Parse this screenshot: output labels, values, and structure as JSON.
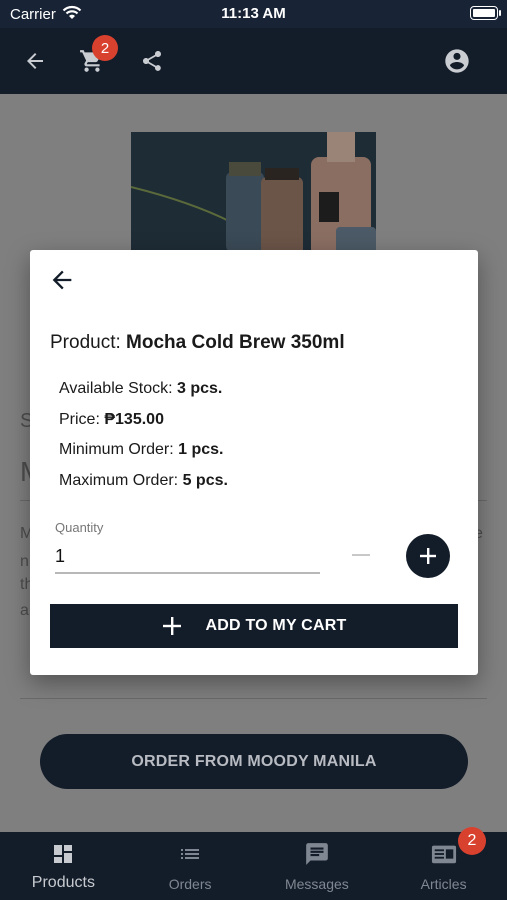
{
  "status_bar": {
    "carrier": "Carrier",
    "time": "11:13 AM"
  },
  "app_bar": {
    "cart_count": "2"
  },
  "background": {
    "section_label_partial": "S",
    "title_partial": "M",
    "desc_lines_partial": [
      "M",
      "n",
      "th",
      "a"
    ],
    "desc_right_partial": "e",
    "order_button": "ORDER FROM MOODY MANILA"
  },
  "dialog": {
    "product_label": "Product:",
    "product_name": "Mocha Cold Brew 350ml",
    "stock_label": "Available Stock:",
    "stock_value": "3 pcs.",
    "price_label": "Price:",
    "price_value": "₱135.00",
    "min_label": "Minimum Order:",
    "min_value": "1 pcs.",
    "max_label": "Maximum Order:",
    "max_value": "5 pcs.",
    "quantity_label": "Quantity",
    "quantity_value": "1",
    "add_button": "ADD TO MY CART"
  },
  "tabs": [
    {
      "label": "Products",
      "icon": "dashboard-icon",
      "active": true
    },
    {
      "label": "Orders",
      "icon": "list-icon",
      "active": false
    },
    {
      "label": "Messages",
      "icon": "message-icon",
      "active": false
    },
    {
      "label": "Articles",
      "icon": "article-icon",
      "active": false
    }
  ],
  "articles_badge": "2",
  "colors": {
    "navy": "#131c29",
    "badge": "#d9412f"
  }
}
